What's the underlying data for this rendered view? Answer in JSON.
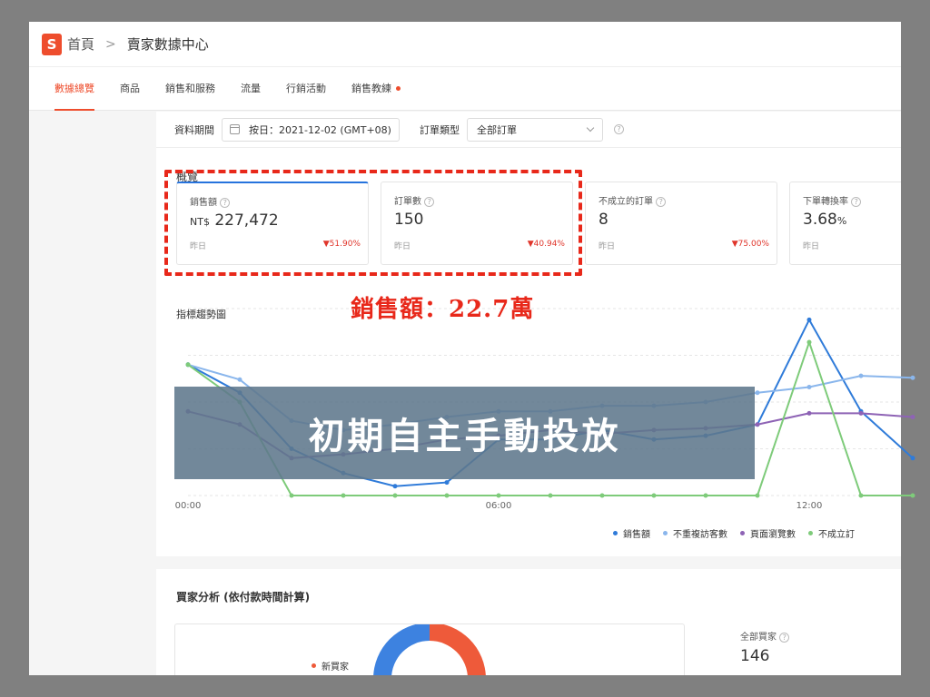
{
  "breadcrumb": {
    "logo": "S",
    "home": "首頁",
    "separator": ">",
    "current": "賣家數據中心"
  },
  "tabs": [
    {
      "label": "數據總覽",
      "active": true
    },
    {
      "label": "商品"
    },
    {
      "label": "銷售和服務"
    },
    {
      "label": "流量"
    },
    {
      "label": "行銷活動"
    },
    {
      "label": "銷售教練",
      "dot": true
    }
  ],
  "filters": {
    "period_label": "資料期間",
    "date_value": "按日：2021-12-02 (GMT+08)",
    "order_type_label": "訂單類型",
    "order_type_value": "全部訂單"
  },
  "overview": {
    "title": "概覽",
    "kpis": [
      {
        "label": "銷售額",
        "prefix": "NT$",
        "value": "227,472",
        "sub": "昨日",
        "change": "▼51.90%"
      },
      {
        "label": "訂單數",
        "value": "150",
        "sub": "昨日",
        "change": "▼40.94%"
      },
      {
        "label": "不成立的訂單",
        "value": "8",
        "sub": "昨日",
        "change": "▼75.00%"
      },
      {
        "label": "下單轉換率",
        "value": "3.68",
        "unit": "%",
        "sub": "昨日"
      }
    ]
  },
  "annotation": "銷售額：22.7萬",
  "banner": "初期自主手動投放",
  "colors": {
    "accent": "#ee4d2d",
    "annotation": "#e8281a",
    "blue": "#2f7bd9",
    "light_blue": "#8ab6ec",
    "purple": "#8e63b5",
    "green": "#7ecb7a"
  },
  "chart_data": {
    "type": "line",
    "title": "指標趨勢圖",
    "x": [
      "00:00",
      "01:00",
      "02:00",
      "03:00",
      "04:00",
      "05:00",
      "06:00",
      "07:00",
      "08:00",
      "09:00",
      "10:00",
      "11:00",
      "12:00",
      "13:00",
      "14:00"
    ],
    "x_tick_labels": [
      "00:00",
      "06:00",
      "12:00"
    ],
    "grid": true,
    "legend_position": "bottom-right",
    "series": [
      {
        "name": "銷售額",
        "color": "#2f7bd9",
        "values": [
          0.7,
          0.55,
          0.25,
          0.12,
          0.05,
          0.07,
          0.3,
          0.3,
          0.35,
          0.3,
          0.32,
          0.38,
          0.94,
          0.45,
          0.2
        ]
      },
      {
        "name": "不重複訪客數",
        "color": "#8ab6ec",
        "values": [
          0.7,
          0.62,
          0.4,
          0.35,
          0.38,
          0.42,
          0.45,
          0.45,
          0.48,
          0.48,
          0.5,
          0.55,
          0.58,
          0.64,
          0.63
        ]
      },
      {
        "name": "頁面瀏覽數",
        "color": "#8e63b5",
        "values": [
          0.45,
          0.38,
          0.2,
          0.22,
          0.25,
          0.3,
          0.32,
          0.35,
          0.33,
          0.35,
          0.36,
          0.38,
          0.44,
          0.44,
          0.42
        ]
      },
      {
        "name": "不成立訂單",
        "color": "#7ecb7a",
        "values": [
          0.7,
          0.5,
          0.0,
          0.0,
          0.0,
          0.0,
          0.0,
          0.0,
          0.0,
          0.0,
          0.0,
          0.0,
          0.82,
          0.0,
          0.0
        ]
      }
    ],
    "legend_labels": [
      "銷售額",
      "不重複訪客數",
      "頁面瀏覽數",
      "不成立訂"
    ]
  },
  "buyers": {
    "title": "買家分析 (依付款時間計算)",
    "legend_new": "新買家",
    "total_label": "全部買家",
    "total_value": "146"
  }
}
